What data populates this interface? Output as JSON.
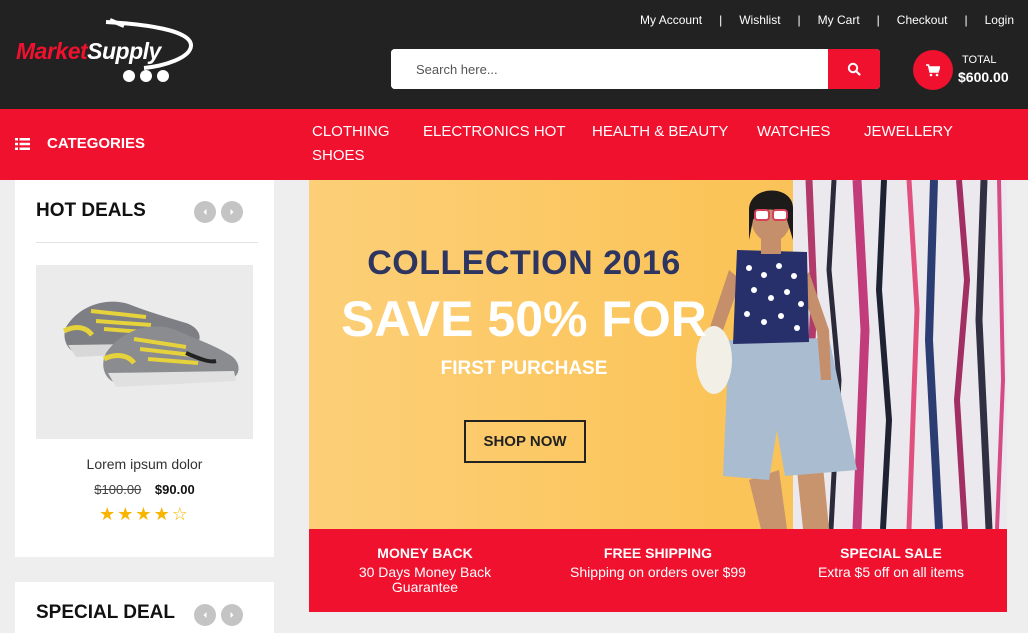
{
  "brand": {
    "part1": "Market",
    "part2": "Supply"
  },
  "top_links": [
    "My Account",
    "Wishlist",
    "My Cart",
    "Checkout",
    "Login"
  ],
  "search": {
    "placeholder": "Search here...",
    "icon": "search-icon"
  },
  "cart": {
    "icon": "cart-icon",
    "total_label": "TOTAL",
    "total_value": "$600.00"
  },
  "nav": {
    "categories_label": "CATEGORIES",
    "items": [
      "CLOTHING",
      "ELECTRONICS HOT",
      "HEALTH & BEAUTY",
      "WATCHES",
      "JEWELLERY",
      "SHOES"
    ]
  },
  "hot_deals": {
    "title": "HOT DEALS",
    "product": {
      "name": "Lorem ipsum dolor",
      "old_price": "$100.00",
      "new_price": "$90.00",
      "rating": 4,
      "rating_max": 5
    }
  },
  "special_deal": {
    "title": "SPECIAL DEAL"
  },
  "banner": {
    "line1": "COLLECTION 2016",
    "line2": "SAVE 50% FOR",
    "line3": "FIRST PURCHASE",
    "button": "SHOP NOW"
  },
  "features": [
    {
      "title": "MONEY BACK",
      "desc": "30 Days Money Back Guarantee"
    },
    {
      "title": "FREE SHIPPING",
      "desc": "Shipping on orders over $99"
    },
    {
      "title": "SPECIAL SALE",
      "desc": "Extra $5 off on all items"
    }
  ],
  "colors": {
    "accent": "#f0112f",
    "dark": "#222222",
    "banner_bg": "#fcc96a",
    "banner_heading": "#2d3560",
    "star": "#f7b500"
  }
}
